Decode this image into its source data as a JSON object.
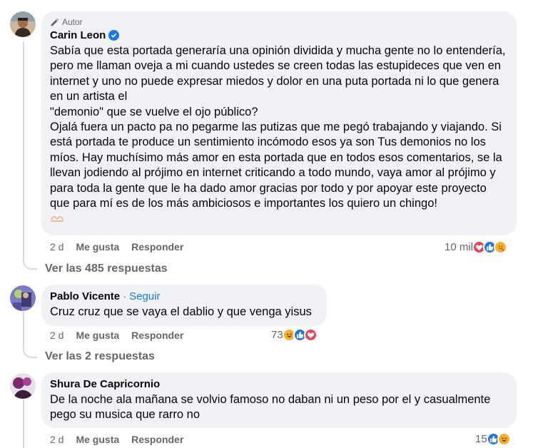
{
  "comments": [
    {
      "author_badge": "Autor",
      "name": "Carin Leon",
      "verified": true,
      "text": "Sabía que esta portada generaría una opinión dividida y mucha gente no lo entendería, pero me llaman oveja a mi cuando ustedes se creen todas las estupideces que ven en internet y uno no puede expresar miedos y dolor en una puta portada ni lo que genera en un artista el\n\"demonio\" que se vuelve el ojo público?\nOjalá fuera un pacto pa no pegarme las putizas que me pegó trabajando y viajando. Si está portada te produce un sentimiento incómodo esos ya son Tus demonios no los míos. Hay muchísimo más amor en esta portada que en todos esos comentarios, se la llevan jodiendo al prójimo en internet criticando a todo mundo, vaya amor al prójimo y para toda la gente que le ha dado amor gracias por todo y por apoyar este proyecto que para mí es de los más ambiciosos e importantes los quiero un chingo!",
      "time": "2 d",
      "like": "Me gusta",
      "reply": "Responder",
      "reaction_count": "10 mil",
      "reactions": [
        "love",
        "like",
        "care"
      ],
      "view_replies": "Ver las 485 respuestas"
    },
    {
      "name": "Pablo Vicente",
      "separator": "·",
      "follow": "Seguir",
      "text": "Cruz cruz que se vaya el dablio y que venga yisus",
      "time": "2 d",
      "like": "Me gusta",
      "reply": "Responder",
      "reaction_count": "73",
      "reactions": [
        "haha",
        "like",
        "love"
      ],
      "view_replies": "Ver las 2 respuestas"
    },
    {
      "name": "Shura De Capricornio",
      "text": "De la noche ala mañana se volvio famoso no daban ni un peso por el y casualmente pego su musica que rarro no",
      "time": "2 d",
      "like": "Me gusta",
      "reply": "Responder",
      "reaction_count": "15",
      "reactions": [
        "like",
        "haha"
      ]
    }
  ],
  "colors": {
    "bubble": "#f0f2f5",
    "secondary_text": "#65676b",
    "link_blue": "#1877f2",
    "love_red": "#f33e58",
    "care_yellow": "#f7b125"
  }
}
